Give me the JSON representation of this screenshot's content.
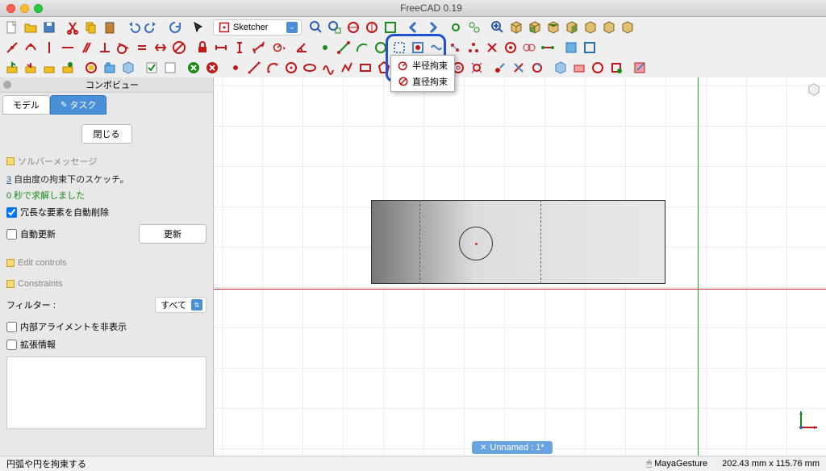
{
  "app": {
    "title": "FreeCAD 0.19"
  },
  "workbench": {
    "current": "Sketcher",
    "icon": "sketcher-icon"
  },
  "combo": {
    "title": "コンボビュー"
  },
  "tabs": {
    "model": "モデル",
    "task": "タスク"
  },
  "task": {
    "close": "閉じる",
    "solver_section": "ソルバーメッセージ",
    "solver_msg_pre": "",
    "dof": "3",
    "solver_msg_post": " 自由度の拘束下のスケッチ。",
    "solved": "0 秒で求解しました",
    "auto_remove_redundant": "冗長な要素を自動削除",
    "auto_update": "自動更新",
    "update": "更新",
    "edit_controls": "Edit controls",
    "constraints_label": "Constraints",
    "filter_label": "フィルター :",
    "filter_value": "すべて",
    "hide_alignment": "内部アライメントを非表示",
    "extended": "拡張情報"
  },
  "dropdown": {
    "radius": "半径拘束",
    "diameter": "直径拘束"
  },
  "document": {
    "tab": "Unnamed : 1*"
  },
  "status": {
    "hint": "円弧や円を拘束する",
    "nav": "MayaGesture",
    "coords": "202.43 mm x 115.76 mm"
  },
  "toolbar_icons": {
    "row1": [
      "new",
      "open",
      "save",
      "sep",
      "cut",
      "copy",
      "paste",
      "sep",
      "undo",
      "redo",
      "sep",
      "refresh",
      "sep",
      "pointer",
      "sep"
    ],
    "row1b": [
      "zoom-fit",
      "zoom-sel",
      "draw-style",
      "sep",
      "nav-back",
      "nav-fwd",
      "sep",
      "linkA",
      "linkB",
      "sep",
      "zoom-in",
      "cube-iso",
      "cube-front",
      "cube-top",
      "cube-right",
      "cube-back",
      "cube-bottom",
      "cube-left"
    ],
    "row2a": [
      "leave",
      "new-sketch",
      "edit-sketch",
      "map",
      "reorient",
      "validate",
      "merge",
      "mirror",
      "sep"
    ],
    "row2b": [
      "point",
      "line",
      "arc",
      "circle",
      "ellipse",
      "bspline",
      "polyline",
      "rect",
      "polygon",
      "slot",
      "fillet",
      "trim",
      "extend",
      "external",
      "carbon",
      "construction",
      "sep"
    ],
    "row2c": [
      "constr-coincident",
      "constr-point-on",
      "constr-vertical",
      "constr-horizontal",
      "constr-parallel",
      "constr-perpendicular",
      "constr-tangent",
      "constr-equal",
      "constr-symmetric",
      "constr-block",
      "sep",
      "constr-lock",
      "constr-hdist",
      "constr-vdist",
      "constr-length",
      "constr-radius-dd",
      "constr-angle",
      "constr-snell"
    ],
    "row3a": [
      "macro-rec",
      "macro-stop",
      "macro-list",
      "macro-run",
      "sep",
      "part",
      "group",
      "sep",
      "check",
      "boolean",
      "sep",
      "stop",
      "sep"
    ],
    "row3b": [
      "c1",
      "c2",
      "c3",
      "c4",
      "c5",
      "c6",
      "c7",
      "c8",
      "c9",
      "c10",
      "c11",
      "c12",
      "c13",
      "c14",
      "c15",
      "c16",
      "c17",
      "c18",
      "c19",
      "c20",
      "c21"
    ]
  }
}
